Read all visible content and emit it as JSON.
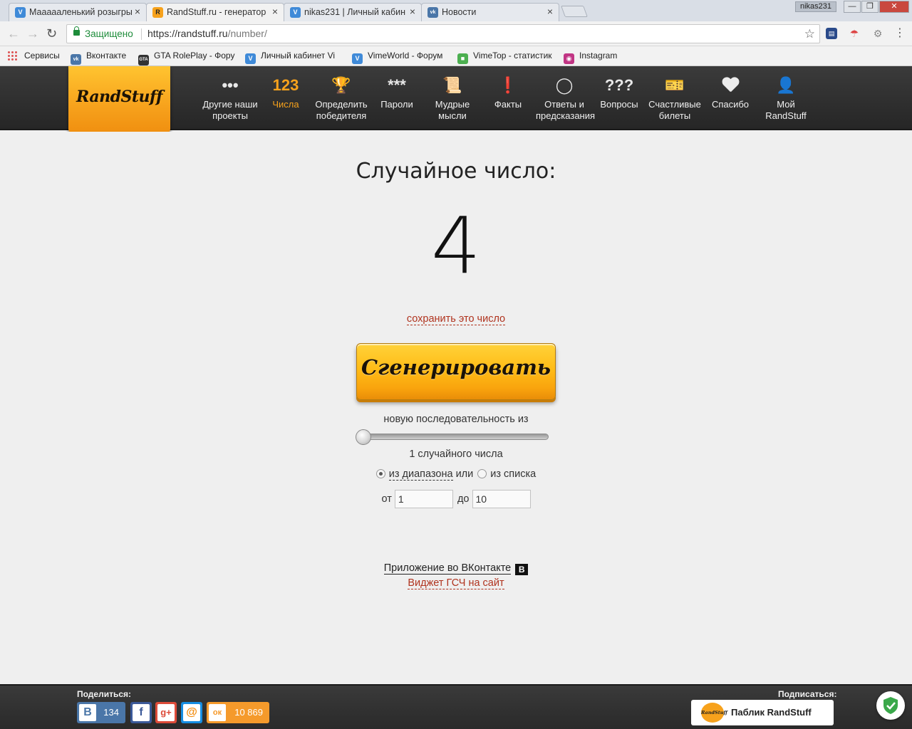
{
  "browser": {
    "tabs": [
      {
        "title": "Маааааленький розыгры",
        "favicon": "V",
        "favicon_color": "#3f8ad8"
      },
      {
        "title": "RandStuff.ru - генератор",
        "favicon": "R",
        "favicon_color": "#f7a21c"
      },
      {
        "title": "nikas231 | Личный кабин",
        "favicon": "V",
        "favicon_color": "#3f8ad8"
      },
      {
        "title": "Новости",
        "favicon": "vk",
        "favicon_color": "#4a76a8"
      }
    ],
    "close_glyph": "×",
    "username": "nikas231",
    "secure_label": "Защищено",
    "url_host": "https://randstuff.ru",
    "url_path": "/number/"
  },
  "bookmarks": [
    {
      "label": "Сервисы"
    },
    {
      "label": "Вконтакте",
      "icon": "vk",
      "color": "#4a76a8"
    },
    {
      "label": "GTA RolePlay - Фору",
      "icon": "gta",
      "color": "#333333"
    },
    {
      "label": "Личный кабинет Vi",
      "icon": "V",
      "color": "#3f8ad8"
    },
    {
      "label": "VimeWorld - Форум",
      "icon": "V",
      "color": "#3f8ad8"
    },
    {
      "label": "VimeTop - статистик",
      "icon": "vt",
      "color": "#4caf50"
    },
    {
      "label": "Instagram",
      "icon": "ig",
      "color": "#c13584"
    }
  ],
  "site": {
    "logo": "RandStuff",
    "nav": [
      {
        "icon": "•••",
        "label": "Другие наши проекты"
      },
      {
        "icon": "123",
        "label": "Числа",
        "active": true
      },
      {
        "icon": "trophy",
        "label": "Определить победителя"
      },
      {
        "icon": "***",
        "label": "Пароли"
      },
      {
        "icon": "scroll",
        "label": "Мудрые мысли"
      },
      {
        "icon": "!",
        "label": "Факты"
      },
      {
        "icon": "8",
        "label": "Ответы и предсказания"
      },
      {
        "icon": "???",
        "label": "Вопросы"
      },
      {
        "icon": "ticket",
        "label": "Счастливые билеты"
      },
      {
        "icon": "heart",
        "label": "Спасибо"
      },
      {
        "icon": "person",
        "label": "Мой RandStuff"
      }
    ]
  },
  "main": {
    "title": "Случайное число:",
    "result": "4",
    "save_link": "сохранить это число",
    "generate_button": "Сгенерировать",
    "sequence_label": "новую последовательность из",
    "count_label": "1 случайного числа",
    "count_slider_fraction": 0,
    "mode_range": "из диапазона",
    "mode_or": "или",
    "mode_list": "из списка",
    "from_label": "от",
    "from_value": "1",
    "to_label": "до",
    "to_value": "10",
    "vk_app_link": "Приложение во ВКонтакте",
    "vk_badge": "В",
    "widget_link": "Виджет ГСЧ на сайт"
  },
  "footer": {
    "share_label": "Поделиться:",
    "subscribe_label": "Подписаться:",
    "shares": [
      {
        "network": "vk",
        "glyph": "В",
        "count": "134",
        "color": "#4a76a8"
      },
      {
        "network": "facebook",
        "glyph": "f",
        "color": "#3b5998"
      },
      {
        "network": "google-plus",
        "glyph": "g+",
        "color": "#dd4b39"
      },
      {
        "network": "mail",
        "glyph": "@",
        "color": "#168de2"
      },
      {
        "network": "odnoklassniki",
        "glyph": "ок",
        "count": "10 869",
        "color": "#f59a2b"
      }
    ],
    "public_button": "Паблик RandStuff",
    "public_logo": "RandStuff"
  }
}
